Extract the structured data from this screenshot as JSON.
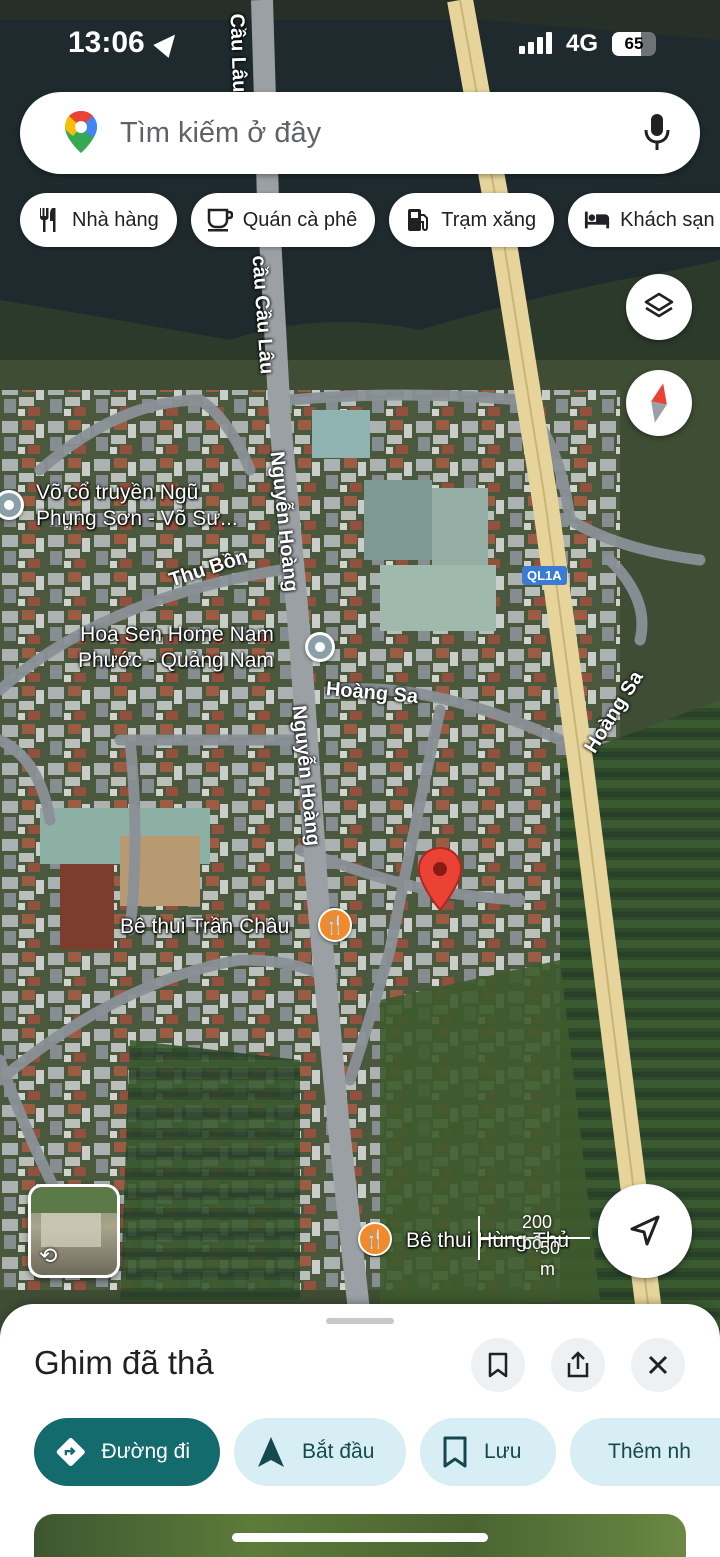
{
  "status_bar": {
    "time": "13:06",
    "network": "4G",
    "battery": "65"
  },
  "search": {
    "placeholder": "Tìm kiếm ở đây"
  },
  "chips": [
    {
      "label": "Nhà hàng",
      "icon": "restaurant-icon"
    },
    {
      "label": "Quán cà phê",
      "icon": "coffee-icon"
    },
    {
      "label": "Trạm xăng",
      "icon": "gas-station-icon"
    },
    {
      "label": "Khách sạn",
      "icon": "hotel-icon"
    }
  ],
  "map": {
    "places": {
      "vo_co": "Võ cổ truyền Ngũ\nPhụng Sơn - Võ Sư...",
      "hoa_sen": "Hoa Sen Home Nam\nPhước - Quảng Nam",
      "be_thui_tran_chau": "Bê thui Trần Châu",
      "be_thui_hung": "Bê thui Hùng Thủ"
    },
    "roads": {
      "cau_lau_top": "Cầu Lâu",
      "cau_cau_lau": "cầu Cầu Lâu",
      "nguyen_hoang_1": "Nguyễn Hoàng",
      "nguyen_hoang_2": "Nguyễn Hoàng",
      "thu_bon": "Thu Bồn",
      "hoang_sa_1": "Hoàng Sa",
      "hoang_sa_2": "Hoàng Sa",
      "ql1a": "QL1A"
    },
    "scale": {
      "imperial": "200 bộ",
      "metric": "50 m"
    }
  },
  "sheet": {
    "title": "Ghim đã thả",
    "actions": [
      {
        "label": "Đường đi",
        "icon": "directions-icon"
      },
      {
        "label": "Bắt đầu",
        "icon": "navigation-arrow-icon"
      },
      {
        "label": "Lưu",
        "icon": "bookmark-icon"
      },
      {
        "label": "Thêm nh",
        "icon": "flag-icon"
      }
    ]
  },
  "colors": {
    "accent": "#136b6e",
    "chip_bg": "#d7eef5",
    "pin": "#ea4335",
    "food_poi": "#f08a2a"
  }
}
